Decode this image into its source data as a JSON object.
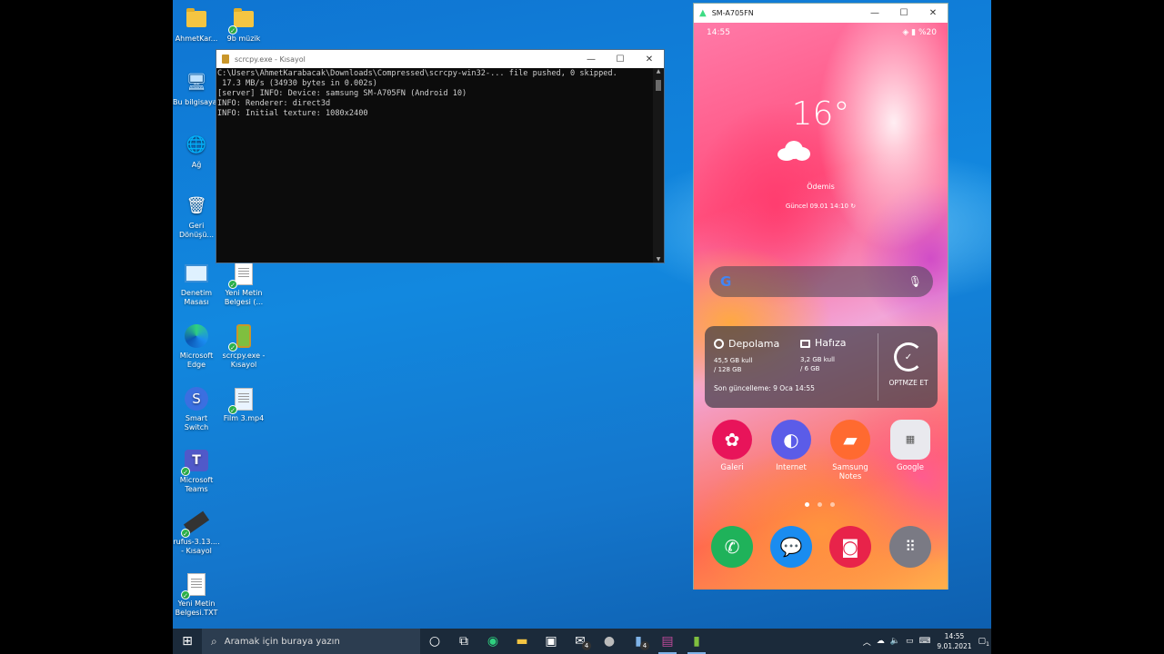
{
  "desktop": {
    "icons": [
      {
        "label": "AhmetKar...",
        "check": false
      },
      {
        "label": "9b müzik",
        "check": true
      },
      {
        "label": "Bu bilgisayar",
        "check": false
      },
      {
        "label": "Ağ",
        "check": false
      },
      {
        "label": "Geri Dönüşü...",
        "check": false
      },
      {
        "label": "Denetim Masası",
        "check": false
      },
      {
        "label": "Yeni Metin Belgesi (...",
        "check": true
      },
      {
        "label": "Microsoft Edge",
        "check": false
      },
      {
        "label": "scrcpy.exe - Kısayol",
        "check": true
      },
      {
        "label": "Smart Switch",
        "check": false
      },
      {
        "label": "Film 3.mp4",
        "check": true
      },
      {
        "label": "Microsoft Teams",
        "check": true
      },
      {
        "label": "rufus-3.13.... - Kısayol",
        "check": true
      },
      {
        "label": "Yeni Metin Belgesi.TXT",
        "check": true
      }
    ]
  },
  "console": {
    "title": "scrcpy.exe - Kısayol",
    "lines": [
      "C:\\Users\\AhmetKarabacak\\Downloads\\Compressed\\scrcpy-win32-... file pushed, 0 skipped.",
      " 17.3 MB/s (34930 bytes in 0.002s)",
      "[server] INFO: Device: samsung SM-A705FN (Android 10)",
      "INFO: Renderer: direct3d",
      "INFO: Initial texture: 1080x2400"
    ]
  },
  "phone_window": {
    "title": "SM-A705FN"
  },
  "phone": {
    "status": {
      "time": "14:55",
      "battery": "%20"
    },
    "weather": {
      "temp": "16°",
      "location": "Ödemis",
      "updated": "Güncel 09.01 14:10"
    },
    "device_care": {
      "storage_title": "Depolama",
      "storage_used": "45,5 GB kull",
      "storage_total": "/ 128 GB",
      "memory_title": "Hafıza",
      "memory_used": "3,2 GB kull",
      "memory_total": "/ 6 GB",
      "last_update": "Son güncelleme: 9 Oca 14:55",
      "optimize": "OPTMZE ET"
    },
    "apps": [
      {
        "label": "Galeri",
        "color": "#e8145a"
      },
      {
        "label": "Internet",
        "color": "#5b5ce8"
      },
      {
        "label": "Samsung Notes",
        "color": "#ff6a30"
      },
      {
        "label": "Google",
        "color": "#e9e9ee"
      }
    ],
    "dock": [
      {
        "name": "phone",
        "color": "#1fb25a"
      },
      {
        "name": "messages",
        "color": "#1a8cf0"
      },
      {
        "name": "camera",
        "color": "#e8234a"
      },
      {
        "name": "apps",
        "color": "#7a7a84"
      }
    ]
  },
  "taskbar": {
    "search_placeholder": "Aramak için buraya yazın",
    "time": "14:55",
    "date": "9.01.2021",
    "mail_badge": "4",
    "phone_badge": "4",
    "notif_badge": "1"
  }
}
